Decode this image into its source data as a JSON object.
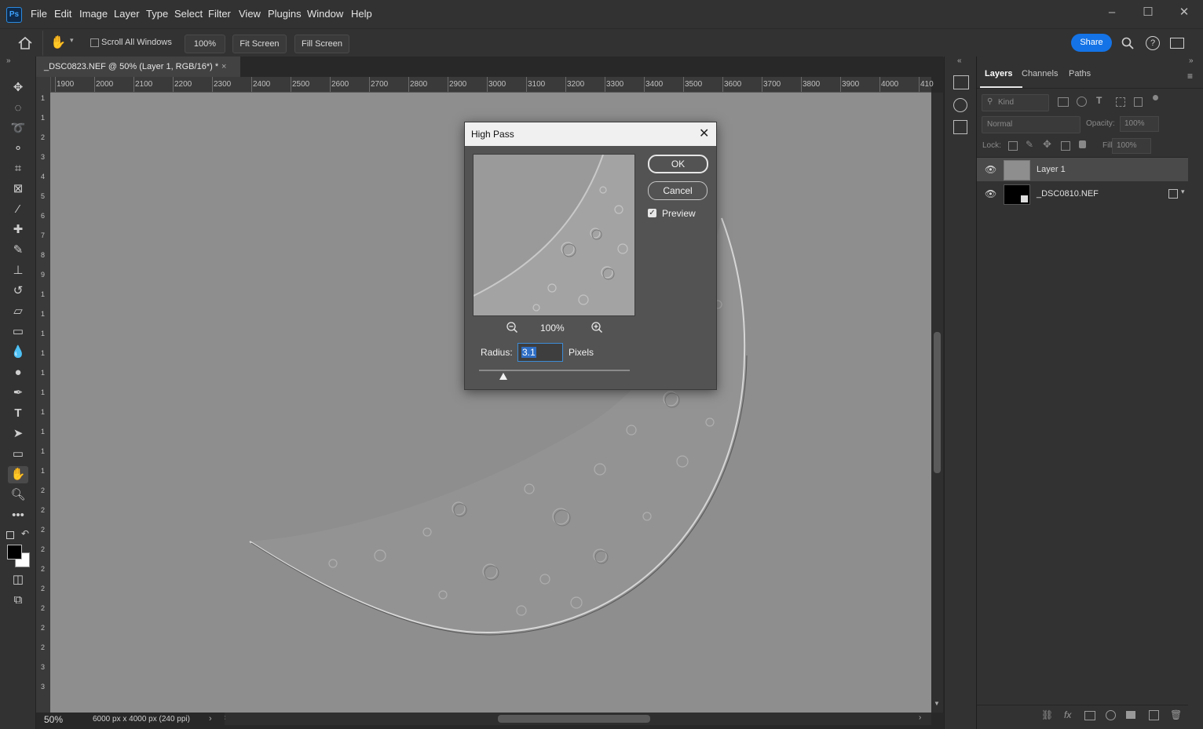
{
  "app": {
    "logo": "Ps"
  },
  "menu": [
    "File",
    "Edit",
    "Image",
    "Layer",
    "Type",
    "Select",
    "Filter",
    "View",
    "Plugins",
    "Window",
    "Help"
  ],
  "options_bar": {
    "scroll_all_windows": "Scroll All Windows",
    "zoom_100": "100%",
    "fit_screen": "Fit Screen",
    "fill_screen": "Fill Screen",
    "share": "Share"
  },
  "document": {
    "tab_title": "_DSC0823.NEF @ 50% (Layer 1, RGB/16*) *",
    "zoom": "50%",
    "info": "6000 px x 4000 px (240 ppi)",
    "ruler_labels": [
      "1900",
      "2000",
      "2100",
      "2200",
      "2300",
      "2400",
      "2500",
      "2600",
      "2700",
      "2800",
      "2900",
      "3000",
      "3100",
      "3200",
      "3300",
      "3400",
      "3500",
      "3600",
      "3700",
      "3800",
      "3900",
      "4000",
      "410"
    ],
    "vruler_labels": [
      "1",
      "1",
      "2",
      "3",
      "4",
      "5",
      "6",
      "7",
      "8",
      "9",
      "1",
      "1",
      "1",
      "1",
      "1",
      "1",
      "1",
      "1",
      "1",
      "1",
      "2",
      "2",
      "2",
      "2",
      "2",
      "2",
      "2",
      "2",
      "2",
      "3",
      "3"
    ]
  },
  "dialog": {
    "title": "High Pass",
    "ok": "OK",
    "cancel": "Cancel",
    "preview_label": "Preview",
    "preview_checked": true,
    "preview_zoom": "100%",
    "radius_label": "Radius:",
    "radius_value": "3.1",
    "radius_units": "Pixels",
    "slider_fraction": 0.16
  },
  "layers_panel": {
    "tabs": [
      "Layers",
      "Channels",
      "Paths"
    ],
    "filter_kind": "Kind",
    "blend_mode": "Normal",
    "opacity_label": "Opacity:",
    "opacity_value": "100%",
    "lock_label": "Lock:",
    "fill_label": "Fill:",
    "fill_value": "100%",
    "layers": [
      {
        "name": "Layer 1",
        "selected": true
      },
      {
        "name": "_DSC0810.NEF",
        "selected": false
      }
    ]
  },
  "colors": {
    "accent": "#1473e6",
    "canvas": "#8f8f8f",
    "panel": "#323232"
  }
}
